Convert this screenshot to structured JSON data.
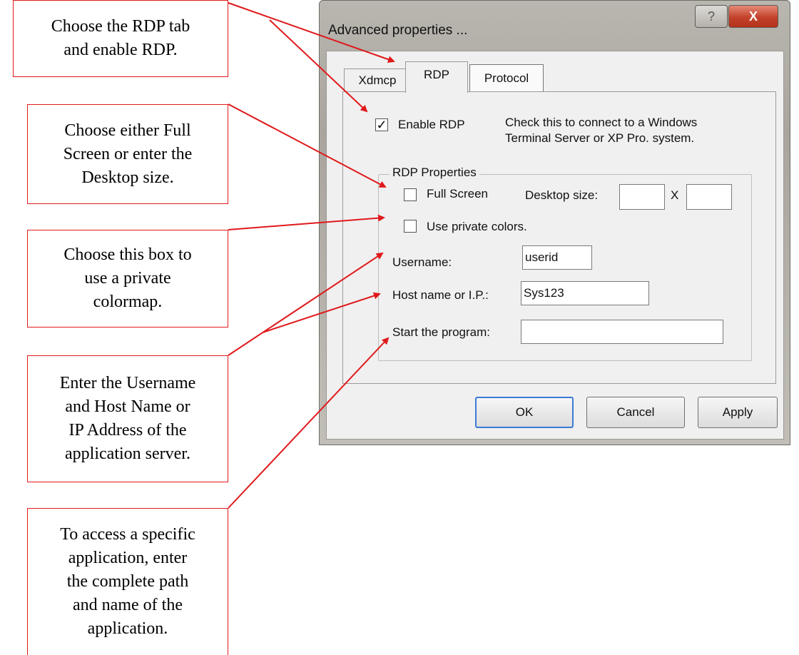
{
  "callouts": {
    "rdp_tab": [
      "Choose the RDP tab",
      "and enable RDP."
    ],
    "screen": [
      "Choose either Full",
      "Screen or enter the",
      "Desktop size."
    ],
    "colors": [
      "Choose this box to",
      "use a private",
      "colormap."
    ],
    "host": [
      "Enter the Username",
      "and Host Name or",
      "IP Address of the",
      "application server."
    ],
    "program": [
      "To access a specific",
      "application, enter",
      "the complete path",
      "and name of the",
      "application."
    ]
  },
  "dialog": {
    "title": "Advanced properties ...",
    "help_glyph": "?",
    "close_glyph": "X",
    "tabs": [
      "Xdmcp",
      "RDP",
      "Protocol"
    ],
    "enable_rdp": {
      "label": "Enable RDP",
      "checked": true,
      "check_glyph": "✓"
    },
    "hint_line1": "Check this to connect to a Windows",
    "hint_line2": "Terminal Server or XP Pro. system.",
    "group_title": "RDP Properties",
    "full_screen": {
      "label": "Full Screen",
      "checked": false
    },
    "desktop_size_label": "Desktop size:",
    "desktop_width": "",
    "desktop_height": "",
    "size_separator": "X",
    "private_colors": {
      "label": "Use private colors.",
      "checked": false
    },
    "username_label": "Username:",
    "username_value": "userid",
    "host_label": "Host name or I.P.:",
    "host_value": "Sys123",
    "program_label": "Start the program:",
    "program_value": "",
    "buttons": {
      "ok": "OK",
      "cancel": "Cancel",
      "apply": "Apply"
    }
  },
  "colors": {
    "annotation": "#e0191b",
    "close_button": "#c3422b",
    "default_button_border": "#3a7bd5"
  }
}
